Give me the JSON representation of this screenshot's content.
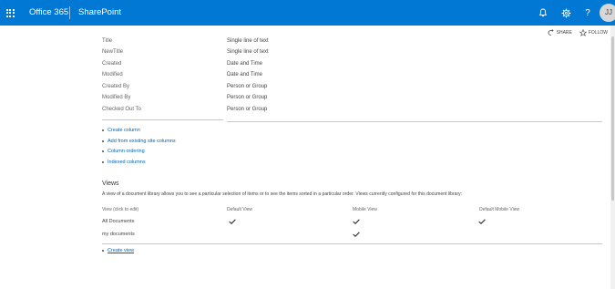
{
  "suite": {
    "brand": "Office 365",
    "app": "SharePoint",
    "avatar_initials": "JJ",
    "accent": "#0078d4"
  },
  "icons": [
    "app-launcher-icon",
    "bell-icon",
    "gear-icon",
    "help-icon",
    "share-icon",
    "star-icon"
  ],
  "actions": {
    "share": "SHARE",
    "follow": "FOLLOW"
  },
  "columns": [
    {
      "name": "Title",
      "type": "Single line of text"
    },
    {
      "name": "NewTitle",
      "type": "Single line of text"
    },
    {
      "name": "Created",
      "type": "Date and Time"
    },
    {
      "name": "Modified",
      "type": "Date and Time"
    },
    {
      "name": "Created By",
      "type": "Person or Group"
    },
    {
      "name": "Modified By",
      "type": "Person or Group"
    },
    {
      "name": "Checked Out To",
      "type": "Person or Group"
    }
  ],
  "column_links": [
    "Create column",
    "Add from existing site columns",
    "Column ordering",
    "Indexed columns"
  ],
  "views": {
    "title": "Views",
    "description": "A view of a document library allows you to see a particular selection of items or to see the items sorted in a particular order. Views currently configured for this document library:",
    "headers": [
      "View (click to edit)",
      "Default View",
      "Mobile View",
      "Default Mobile View"
    ],
    "rows": [
      {
        "name": "All Documents",
        "default_view": true,
        "mobile_view": true,
        "default_mobile_view": true
      },
      {
        "name": "my documents",
        "default_view": false,
        "mobile_view": true,
        "default_mobile_view": false
      }
    ],
    "create_link": "Create view"
  }
}
